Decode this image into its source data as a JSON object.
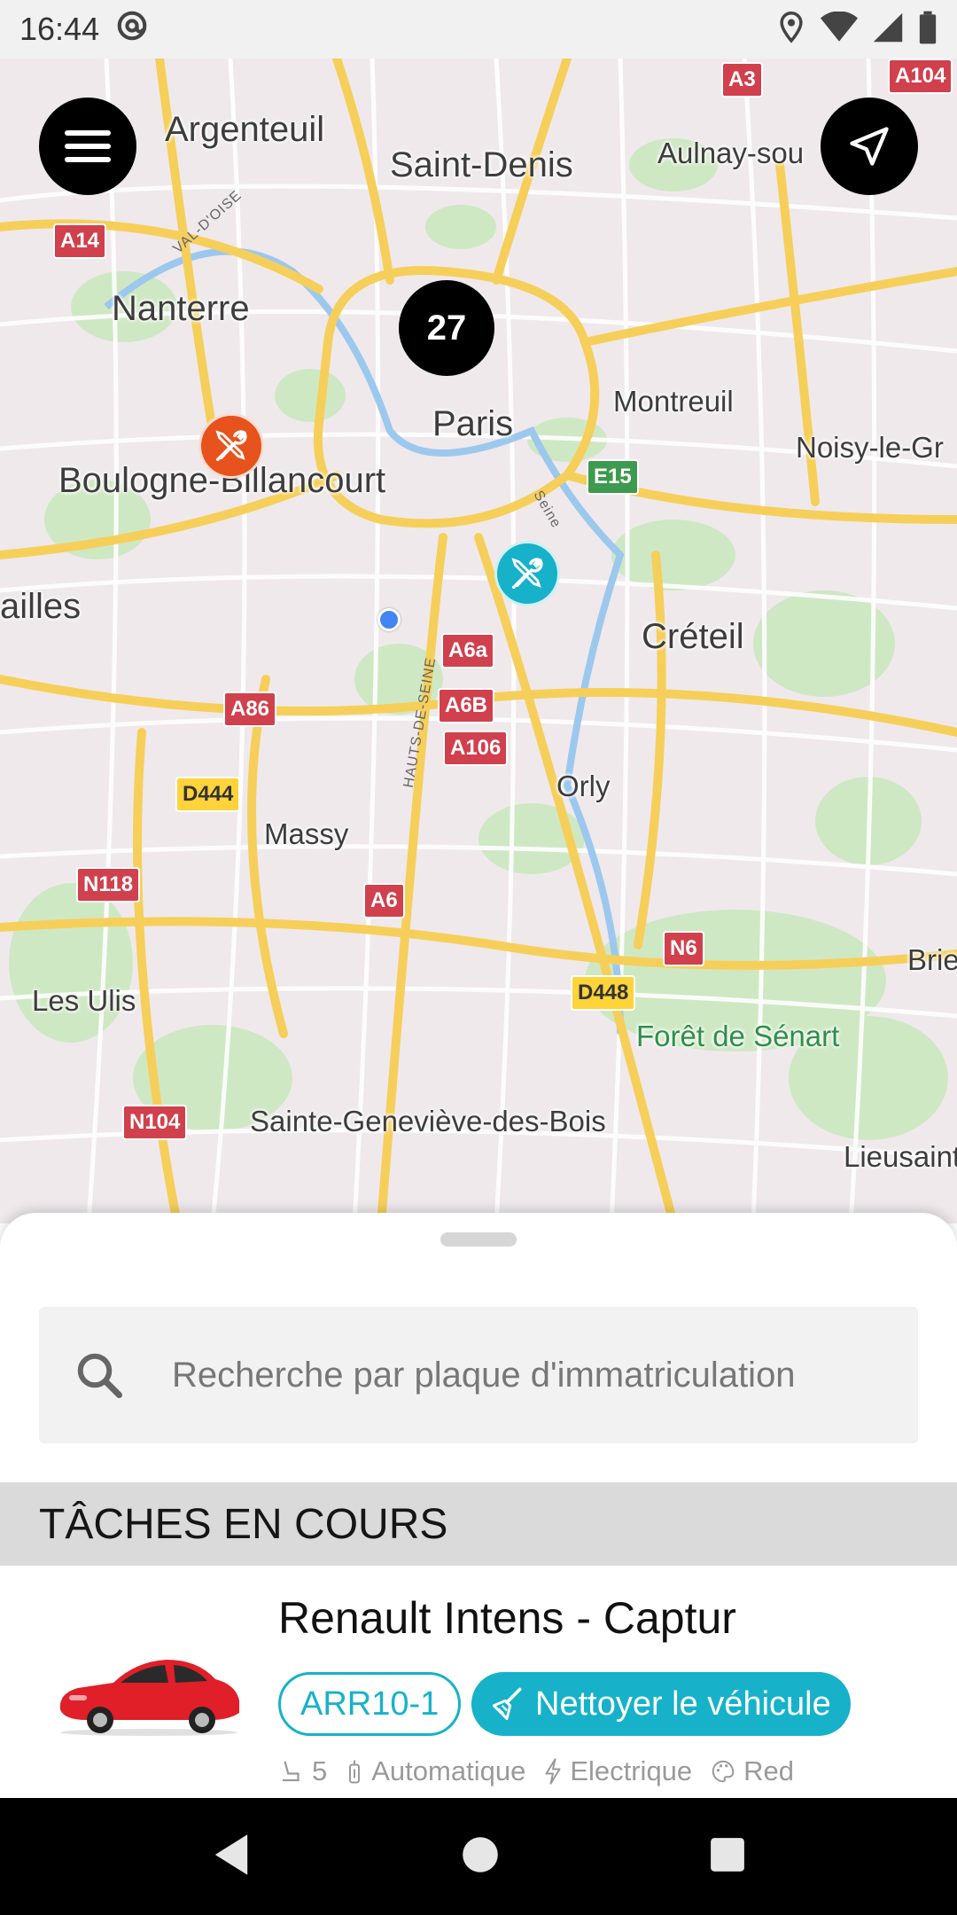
{
  "status_bar": {
    "time": "16:44"
  },
  "map": {
    "cluster_count": "27",
    "places": {
      "argenteuil": "Argenteuil",
      "saint_denis": "Saint-Denis",
      "aulnay": "Aulnay-sou",
      "nanterre": "Nanterre",
      "paris": "Paris",
      "montreuil": "Montreuil",
      "noisy": "Noisy-le-Gr",
      "boulogne": "Boulogne-Billancourt",
      "versailles": "ailles",
      "creteil": "Créteil",
      "orly": "Orly",
      "massy": "Massy",
      "les_ulis": "Les Ulis",
      "brie": "Brie",
      "foret": "Forêt de Sénart",
      "sainte_genevieve": "Sainte-Geneviève-des-Bois",
      "lieusaint": "Lieusaint"
    },
    "roads": {
      "a3": "A3",
      "a104": "A104",
      "a14": "A14",
      "e15": "E15",
      "a6a": "A6a",
      "a6b": "A6B",
      "a106": "A106",
      "a86": "A86",
      "d444": "D444",
      "n118": "N118",
      "a6": "A6",
      "n6": "N6",
      "d448": "D448",
      "n104": "N104"
    },
    "small_labels": {
      "val_doise": "VAL-D'OISE",
      "hauts_de_seine": "HAUTS-DE-SEINE",
      "seine": "Seine"
    },
    "colors": {
      "clean_pin": "#17b2c9",
      "repair_pin": "#e8521c"
    }
  },
  "search": {
    "placeholder": "Recherche par plaque d'immatriculation"
  },
  "tasks": {
    "header": "TÂCHES EN COURS",
    "items": [
      {
        "title": "Renault Intens - Captur",
        "plate": "ARR10-1",
        "action": "Nettoyer le véhicule",
        "seats": "5",
        "transmission": "Automatique",
        "energy": "Electrique",
        "color": "Red"
      }
    ]
  },
  "accent_color": "#17b2c9"
}
